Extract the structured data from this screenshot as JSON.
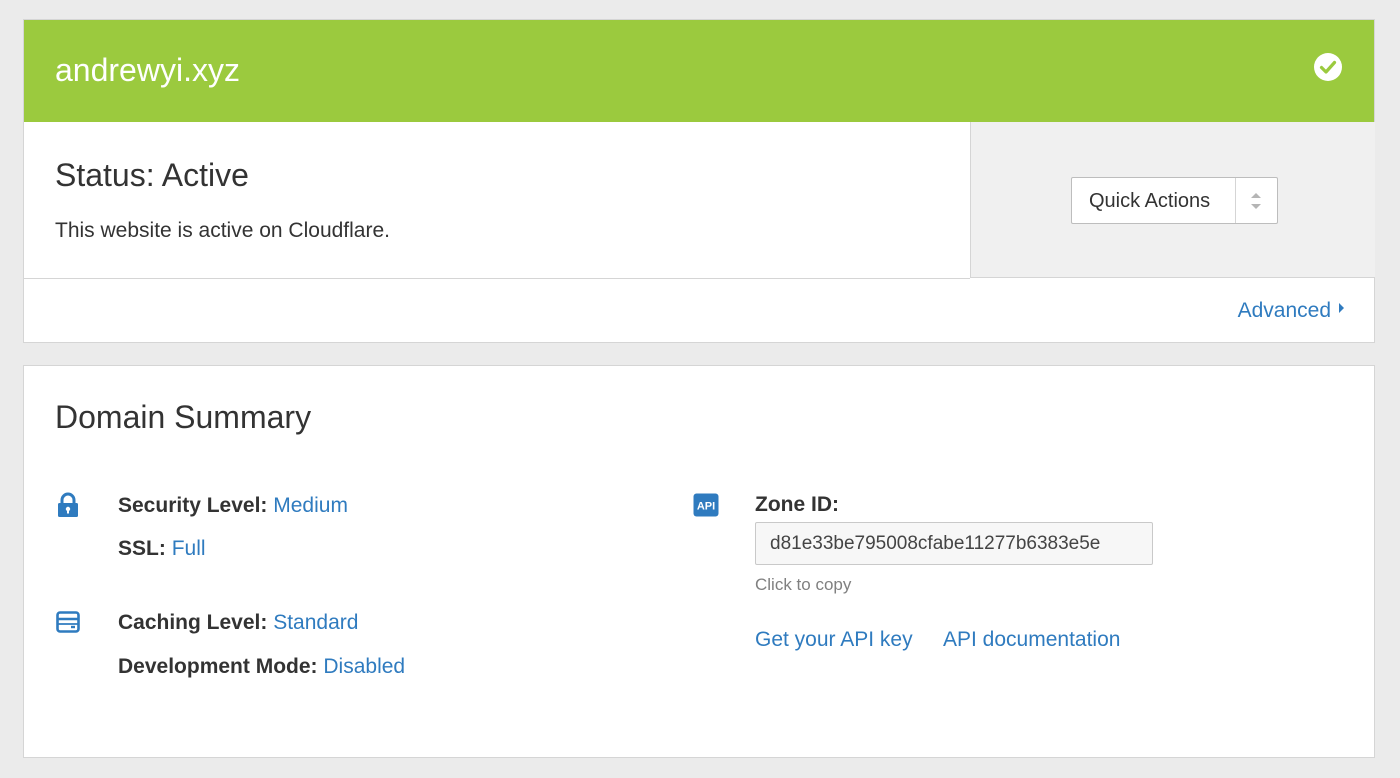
{
  "header": {
    "domain": "andrewyi.xyz",
    "status_icon": "check-circle-icon",
    "accent_color": "#9bca3e"
  },
  "status": {
    "title": "Status: Active",
    "description": "This website is active on Cloudflare."
  },
  "quick_actions": {
    "label": "Quick Actions",
    "icon": "sort-arrows-icon"
  },
  "advanced": {
    "label": "Advanced",
    "icon": "caret-right-icon"
  },
  "summary": {
    "title": "Domain Summary",
    "security": {
      "icon": "lock-icon",
      "level_label": "Security Level:",
      "level_value": "Medium",
      "ssl_label": "SSL:",
      "ssl_value": "Full"
    },
    "caching": {
      "icon": "server-icon",
      "level_label": "Caching Level:",
      "level_value": "Standard",
      "devmode_label": "Development Mode:",
      "devmode_value": "Disabled"
    },
    "api": {
      "icon": "api-badge-icon",
      "badge_text": "API",
      "zone_label": "Zone ID:",
      "zone_value": "d81e33be795008cfabe11277b6383e5e",
      "copy_hint": "Click to copy",
      "get_key_link": "Get your API key",
      "docs_link": "API documentation"
    }
  },
  "colors": {
    "link": "#2f7bbf",
    "background": "#ebebeb"
  }
}
